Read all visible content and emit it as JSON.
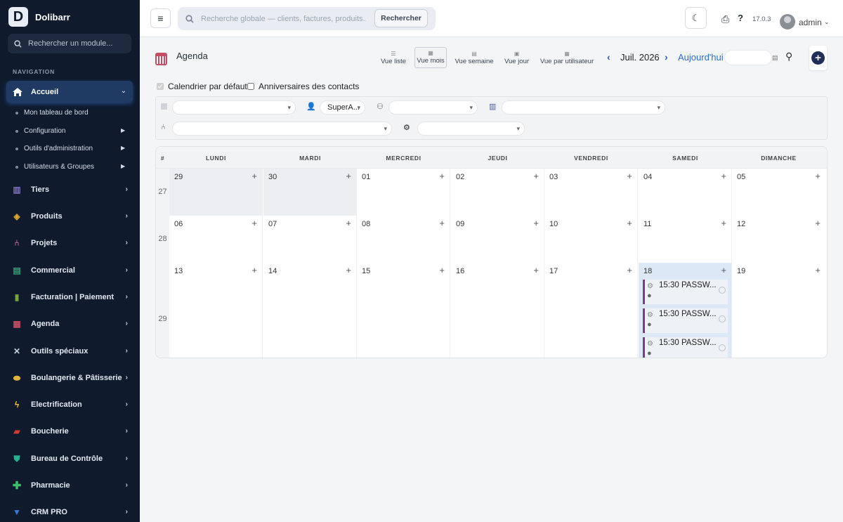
{
  "brand": {
    "logo_letter": "D",
    "name": "Dolibarr"
  },
  "sidebar": {
    "search_placeholder": "Rechercher un module...",
    "nav_label": "NAVIGATION",
    "active": {
      "label": "Accueil",
      "icon": "home-icon"
    },
    "subitems": [
      {
        "label": "Mon tableau de bord",
        "has_arrow": false
      },
      {
        "label": "Configuration",
        "has_arrow": true
      },
      {
        "label": "Outils d'administration",
        "has_arrow": true
      },
      {
        "label": "Utilisateurs & Groupes",
        "has_arrow": true
      }
    ],
    "items": [
      {
        "label": "Tiers",
        "icon": "building-icon",
        "color": "#7c6fb6"
      },
      {
        "label": "Produits",
        "icon": "box-icon",
        "color": "#d9a62e"
      },
      {
        "label": "Projets",
        "icon": "sitemap-icon",
        "color": "#b5618a"
      },
      {
        "label": "Commercial",
        "icon": "suitcase-icon",
        "color": "#3a9a7a"
      },
      {
        "label": "Facturation | Paiement",
        "icon": "invoice-icon",
        "color": "#7aa33a"
      },
      {
        "label": "Agenda",
        "icon": "calendar-icon",
        "color": "#c44d64"
      },
      {
        "label": "Outils spéciaux",
        "icon": "tools-icon",
        "color": "#c9d1dd"
      },
      {
        "label": "Boulangerie & Pâtisserie",
        "icon": "bread-icon",
        "color": "#e0b33a"
      },
      {
        "label": "Electrification",
        "icon": "bolt-icon",
        "color": "#f2c21b"
      },
      {
        "label": "Boucherie",
        "icon": "meat-icon",
        "color": "#d03a2f"
      },
      {
        "label": "Bureau de Contrôle",
        "icon": "shield-icon",
        "color": "#2ab08c"
      },
      {
        "label": "Pharmacie",
        "icon": "cross-icon",
        "color": "#3cc06a"
      },
      {
        "label": "CRM PRO",
        "icon": "funnel-icon",
        "color": "#3a7ae0"
      }
    ]
  },
  "topbar": {
    "search_placeholder": "Recherche globale — clients, factures, produits...",
    "search_button": "Rechercher",
    "version": "17.0.3",
    "user": "admin"
  },
  "agenda": {
    "title": "Agenda",
    "views": [
      {
        "label": "Vue liste",
        "selected": false
      },
      {
        "label": "Vue mois",
        "selected": true
      },
      {
        "label": "Vue semaine",
        "selected": false
      },
      {
        "label": "Vue jour",
        "selected": false
      },
      {
        "label": "Vue par utilisateur",
        "selected": false
      }
    ],
    "month": "Juil. 2026",
    "today_label": "Aujourd'hui",
    "checkboxes": [
      {
        "label": "Calendrier par défaut",
        "checked": true
      },
      {
        "label": "Anniversaires des contacts",
        "checked": false
      }
    ],
    "filters": {
      "user_value": "SuperA..."
    }
  },
  "calendar": {
    "week_col": "#",
    "days": [
      "LUNDI",
      "MARDI",
      "MERCREDI",
      "JEUDI",
      "VENDREDI",
      "SAMEDI",
      "DIMANCHE"
    ],
    "weeks": [
      {
        "num": "27",
        "dates": [
          "29",
          "30",
          "01",
          "02",
          "03",
          "04",
          "05"
        ]
      },
      {
        "num": "28",
        "dates": [
          "06",
          "07",
          "08",
          "09",
          "10",
          "11",
          "12"
        ]
      },
      {
        "num": "29",
        "dates": [
          "13",
          "14",
          "15",
          "16",
          "17",
          "18",
          "19"
        ]
      }
    ],
    "events": [
      {
        "time_title": "15:30 PASSW..."
      },
      {
        "time_title": "15:30 PASSW..."
      },
      {
        "time_title": "15:30 PASSW..."
      }
    ]
  }
}
